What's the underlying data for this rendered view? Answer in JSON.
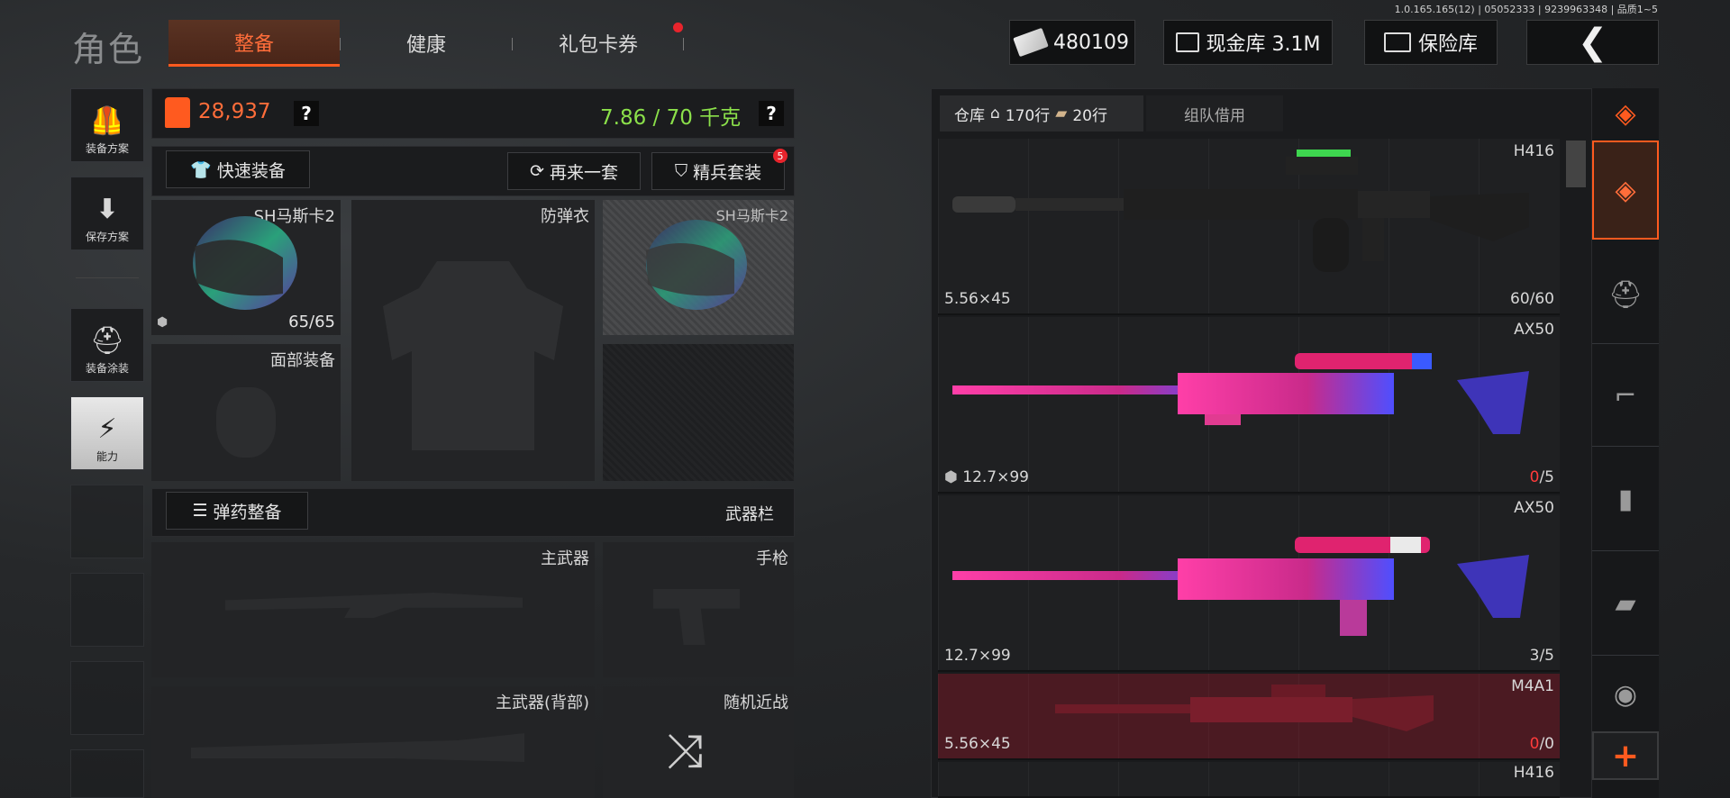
{
  "version": "1.0.165.165(12) | 05052333 | 9239963348 | 品质1~5",
  "title": "角色",
  "tabs": [
    {
      "label": "整备",
      "active": true
    },
    {
      "label": "健康",
      "active": false
    },
    {
      "label": "礼包卡券",
      "active": false,
      "badge_dot": true
    }
  ],
  "topbar": {
    "currency": "480109",
    "cash_vault": "现金库 3.1M",
    "insurance": "保险库"
  },
  "sidebar": [
    {
      "label": "装备方案",
      "icon": "vest-icon"
    },
    {
      "label": "保存方案",
      "icon": "download-icon"
    },
    {
      "label": "装备涂装",
      "icon": "soldier-helmet-icon"
    },
    {
      "label": "能力",
      "icon": "lightning-hex-icon"
    }
  ],
  "loadout": {
    "value": "28,937",
    "weight": "7.86 / 70 千克",
    "quick_equip": "快速装备",
    "again": "再来一套",
    "elite": "精兵套装",
    "elite_badge": "5",
    "ammo_equip": "弹药整备",
    "weapon_bar": "武器栏"
  },
  "slots": {
    "helmet": {
      "name": "SH马斯卡2",
      "durability": "65/65"
    },
    "armor": {
      "label": "防弹衣"
    },
    "helmet_copy": {
      "name": "SH马斯卡2"
    },
    "face": {
      "label": "面部装备"
    },
    "primary": {
      "label": "主武器"
    },
    "pistol": {
      "label": "手枪"
    },
    "primary_back": {
      "label": "主武器(背部)"
    },
    "melee": {
      "label": "随机近战"
    }
  },
  "warehouse": {
    "tab_storage": "仓库",
    "rows": "170行",
    "ammo_rows": "20行",
    "tab_team": "组队借用",
    "items": [
      {
        "name": "H416",
        "caliber": "5.56×45",
        "count": "60/60",
        "count_red": "",
        "count_rest": "",
        "red": false
      },
      {
        "name": "AX50",
        "caliber": "12.7×99",
        "count": "",
        "count_red": "0",
        "count_rest": "/5",
        "red": false
      },
      {
        "name": "AX50",
        "caliber": "12.7×99",
        "count": "3/5",
        "count_red": "",
        "count_rest": "",
        "red": false
      },
      {
        "name": "M4A1",
        "caliber": "5.56×45",
        "count": "",
        "count_red": "0",
        "count_rest": "/0",
        "red": true
      },
      {
        "name": "H416",
        "caliber": "",
        "count": "",
        "count_red": "",
        "count_rest": "",
        "red": false
      }
    ]
  },
  "categories": [
    "layers-refresh-icon",
    "layers-icon",
    "helmet-icon",
    "rifle-icon",
    "magazine-icon",
    "ammo-icon",
    "scope-icon"
  ],
  "colors": {
    "accent": "#ff5a1f",
    "weight_green": "#8be04a",
    "value_orange": "#ff6d3a",
    "alert_red": "#e8242c"
  }
}
